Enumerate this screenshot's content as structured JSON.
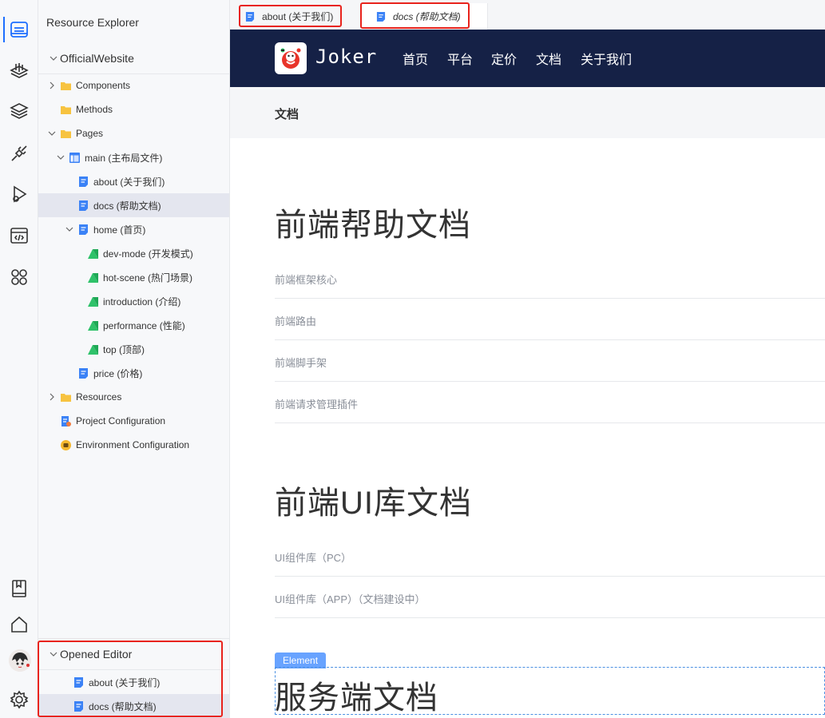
{
  "explorer": {
    "title": "Resource Explorer",
    "project": "OfficialWebsite",
    "tree": [
      {
        "label": "Components",
        "type": "folder"
      },
      {
        "label": "Methods",
        "type": "folder"
      },
      {
        "label": "Pages",
        "type": "folder"
      },
      {
        "label": "main (主布局文件)",
        "type": "layout"
      },
      {
        "label": "about (关于我们)",
        "type": "page"
      },
      {
        "label": "docs (帮助文档)",
        "type": "page",
        "selected": true
      },
      {
        "label": "home (首页)",
        "type": "page"
      },
      {
        "label": "dev-mode (开发模式)",
        "type": "section"
      },
      {
        "label": "hot-scene (热门场景)",
        "type": "section"
      },
      {
        "label": "introduction (介绍)",
        "type": "section"
      },
      {
        "label": "performance (性能)",
        "type": "section"
      },
      {
        "label": "top (顶部)",
        "type": "section"
      },
      {
        "label": "price (价格)",
        "type": "page"
      },
      {
        "label": "Resources",
        "type": "folder"
      },
      {
        "label": "Project Configuration",
        "type": "config"
      },
      {
        "label": "Environment Configuration",
        "type": "env"
      }
    ]
  },
  "opened_editor": {
    "title": "Opened Editor",
    "items": [
      {
        "label": "about (关于我们)"
      },
      {
        "label": "docs (帮助文档)",
        "selected": true
      }
    ]
  },
  "tabs": [
    {
      "label": "about (关于我们)"
    },
    {
      "label": "docs (帮助文档)",
      "active": true
    }
  ],
  "preview": {
    "brand": "Joker",
    "nav": [
      "首页",
      "平台",
      "定价",
      "文档",
      "关于我们"
    ],
    "breadcrumb": "文档",
    "section1": {
      "title": "前端帮助文档",
      "links": [
        "前端框架核心",
        "前端路由",
        "前端脚手架",
        "前端请求管理插件"
      ]
    },
    "section2": {
      "title": "前端UI库文档",
      "links": [
        "UI组件库（PC）",
        "UI组件库（APP）（文档建设中）"
      ]
    },
    "section3": {
      "badge": "Element",
      "title": "服务端文档"
    }
  },
  "colors": {
    "accent": "#1e6fff",
    "nav_bg": "#152146",
    "highlight": "#e8231c",
    "folder": "#f7c340",
    "page_icon": "#3b82f6",
    "section_icon": "#2fc26a"
  },
  "icons": {
    "activity": [
      "explorer-icon",
      "data-layers-icon",
      "layers-icon",
      "plugin-icon",
      "run-icon",
      "code-icon",
      "apps-icon",
      "book-icon",
      "home-icon",
      "avatar",
      "settings-icon"
    ]
  }
}
